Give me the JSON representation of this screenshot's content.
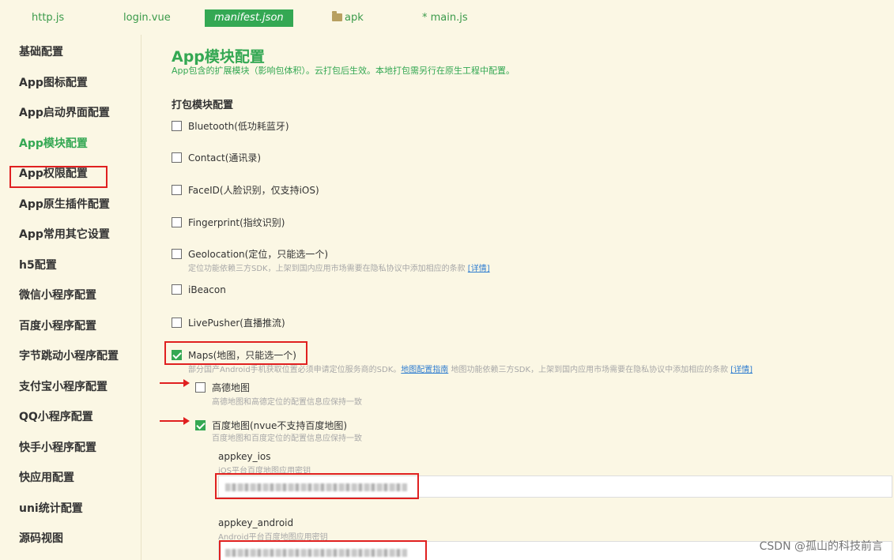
{
  "tabs": {
    "t1": "http.js",
    "t2": "login.vue",
    "t3": "manifest.json",
    "t4": "apk",
    "t5": "* main.js"
  },
  "sidebar": {
    "items": [
      "基础配置",
      "App图标配置",
      "App启动界面配置",
      "App模块配置",
      "App权限配置",
      "App原生插件配置",
      "App常用其它设置",
      "h5配置",
      "微信小程序配置",
      "百度小程序配置",
      "字节跳动小程序配置",
      "支付宝小程序配置",
      "QQ小程序配置",
      "快手小程序配置",
      "快应用配置",
      "uni统计配置",
      "源码视图"
    ]
  },
  "main": {
    "title": "App模块配置",
    "description": "App包含的扩展模块（影响包体积）。云打包后生效。本地打包需另行在原生工程中配置。",
    "section_title": "打包模块配置",
    "modules": {
      "bluetooth": "Bluetooth(低功耗蓝牙)",
      "contact": "Contact(通讯录)",
      "faceid": "FaceID(人脸识别，仅支持iOS)",
      "fingerprint": "Fingerprint(指纹识别)",
      "geolocation": "Geolocation(定位，只能选一个)",
      "geolocation_note": "定位功能依赖三方SDK，上架到国内应用市场需要在隐私协议中添加相应的条款",
      "geolocation_link": "[详情]",
      "ibeacon": "iBeacon",
      "livepusher": "LivePusher(直播推流)",
      "maps": "Maps(地图，只能选一个)",
      "maps_note_a": "部分国产Android手机获取位置必须申请定位服务商的SDK。",
      "maps_link_a": "地图配置指南",
      "maps_note_b": " 地图功能依赖三方SDK，上架到国内应用市场需要在隐私协议中添加相应的条款",
      "maps_link_b": "[详情]",
      "amap": "高德地图",
      "amap_note": "高德地图和高德定位的配置信息应保持一致",
      "baidu": "百度地图(nvue不支持百度地图)",
      "baidu_note": "百度地图和百度定位的配置信息应保持一致"
    },
    "fields": {
      "ios_label": "appkey_ios",
      "ios_hint": "iOS平台百度地图应用密钥",
      "android_label": "appkey_android",
      "android_hint": "Android平台百度地图应用密钥"
    },
    "checked": {
      "maps": true,
      "amap": false,
      "baidu": true
    }
  },
  "watermark": "CSDN @孤山的科技前言",
  "colors": {
    "accent": "#34a853",
    "highlight": "#e02020",
    "background": "#fbf7e4"
  }
}
